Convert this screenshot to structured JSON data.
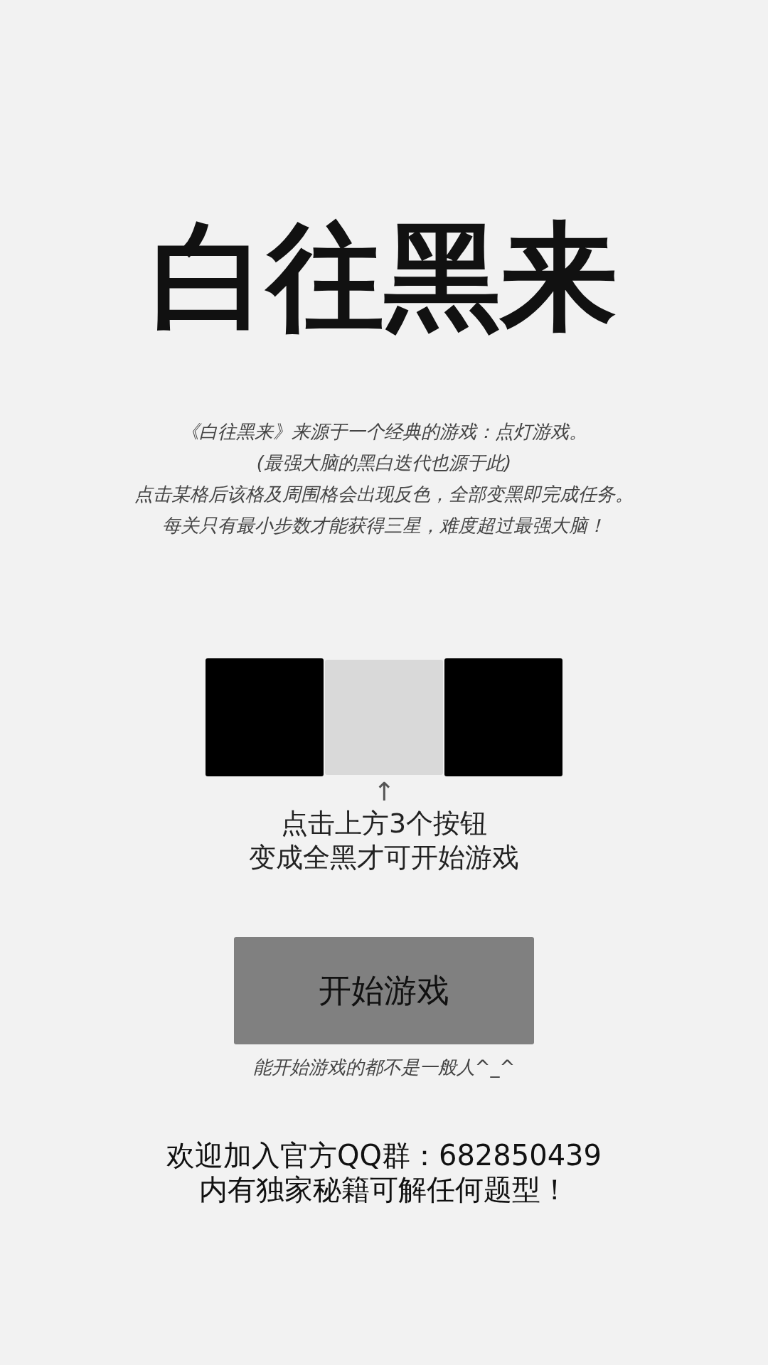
{
  "title": "白往黑来",
  "description": [
    "《白往黑来》来源于一个经典的游戏：点灯游戏。",
    "(最强大脑的黑白迭代也源于此)",
    "点击某格后该格及周围格会出现反色，全部变黑即完成任务。",
    "每关只有最小步数才能获得三星，难度超过最强大脑！"
  ],
  "tiles": [
    {
      "black": true
    },
    {
      "black": false
    },
    {
      "black": true
    }
  ],
  "hint": {
    "arrow": "↑",
    "lines": [
      "点击上方3个按钮",
      "变成全黑才可开始游戏"
    ]
  },
  "start_button": {
    "label": "开始游戏",
    "disabled": true
  },
  "caption": "能开始游戏的都不是一般人^_^",
  "footer": [
    "欢迎加入官方QQ群：682850439",
    "内有独家秘籍可解任何题型！"
  ]
}
